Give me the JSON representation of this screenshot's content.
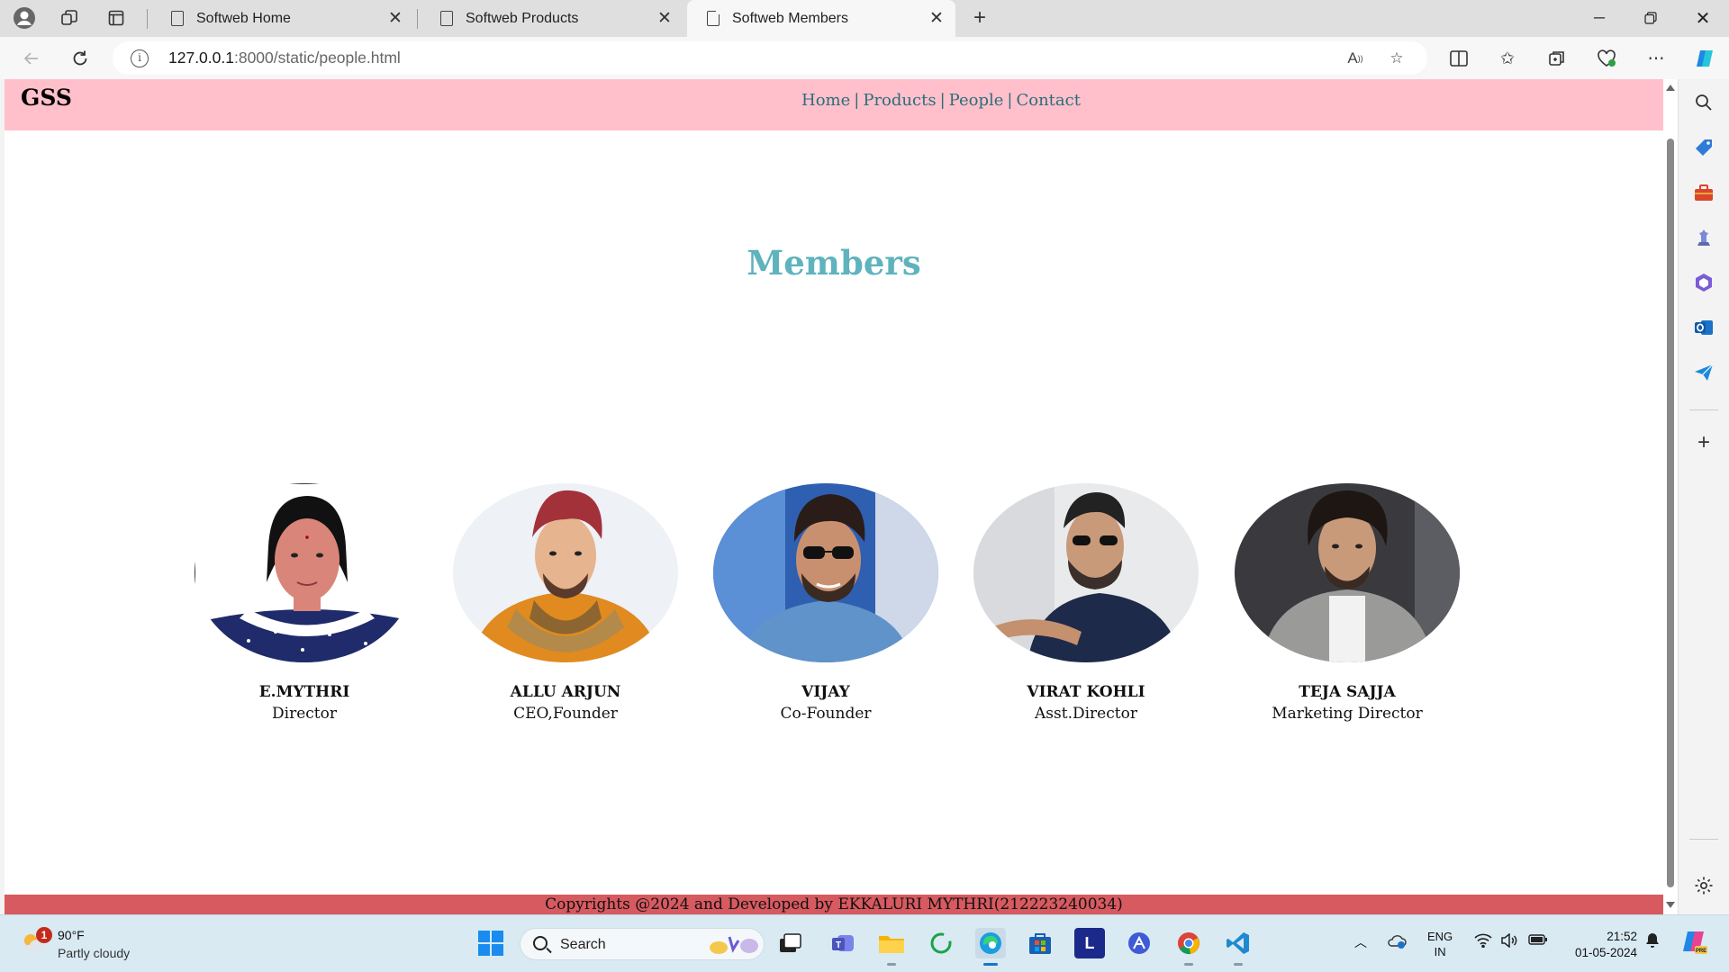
{
  "browser": {
    "tabs": [
      {
        "title": "Softweb Home"
      },
      {
        "title": "Softweb Products"
      },
      {
        "title": "Softweb Members"
      }
    ],
    "url_host": "127.0.0.1",
    "url_path": ":8000/static/people.html"
  },
  "site": {
    "logo": "GSS",
    "nav": [
      "Home",
      "Products",
      "People",
      "Contact"
    ],
    "nav_separator": "|",
    "title": "Members",
    "members": [
      {
        "name": "E.MYTHRI",
        "role": "Director"
      },
      {
        "name": "ALLU ARJUN",
        "role": "CEO,Founder"
      },
      {
        "name": "VIJAY",
        "role": "Co-Founder"
      },
      {
        "name": "VIRAT KOHLI",
        "role": "Asst.Director"
      },
      {
        "name": "TEJA SAJJA",
        "role": "Marketing Director"
      }
    ],
    "footer": "Copyrights @2024 and Developed by EKKALURI MYTHRI(212223240034)",
    "colors": {
      "header_bg": "#ffc0cb",
      "title": "#5fb3bc",
      "nav_link": "#2a6e7a",
      "footer_bg": "#d65a60"
    }
  },
  "taskbar": {
    "weather_badge": "1",
    "weather_temp": "90°F",
    "weather_desc": "Partly cloudy",
    "search_label": "Search",
    "lang_line1": "ENG",
    "lang_line2": "IN",
    "time": "21:52",
    "date": "01-05-2024",
    "app_letter_l": "L"
  }
}
